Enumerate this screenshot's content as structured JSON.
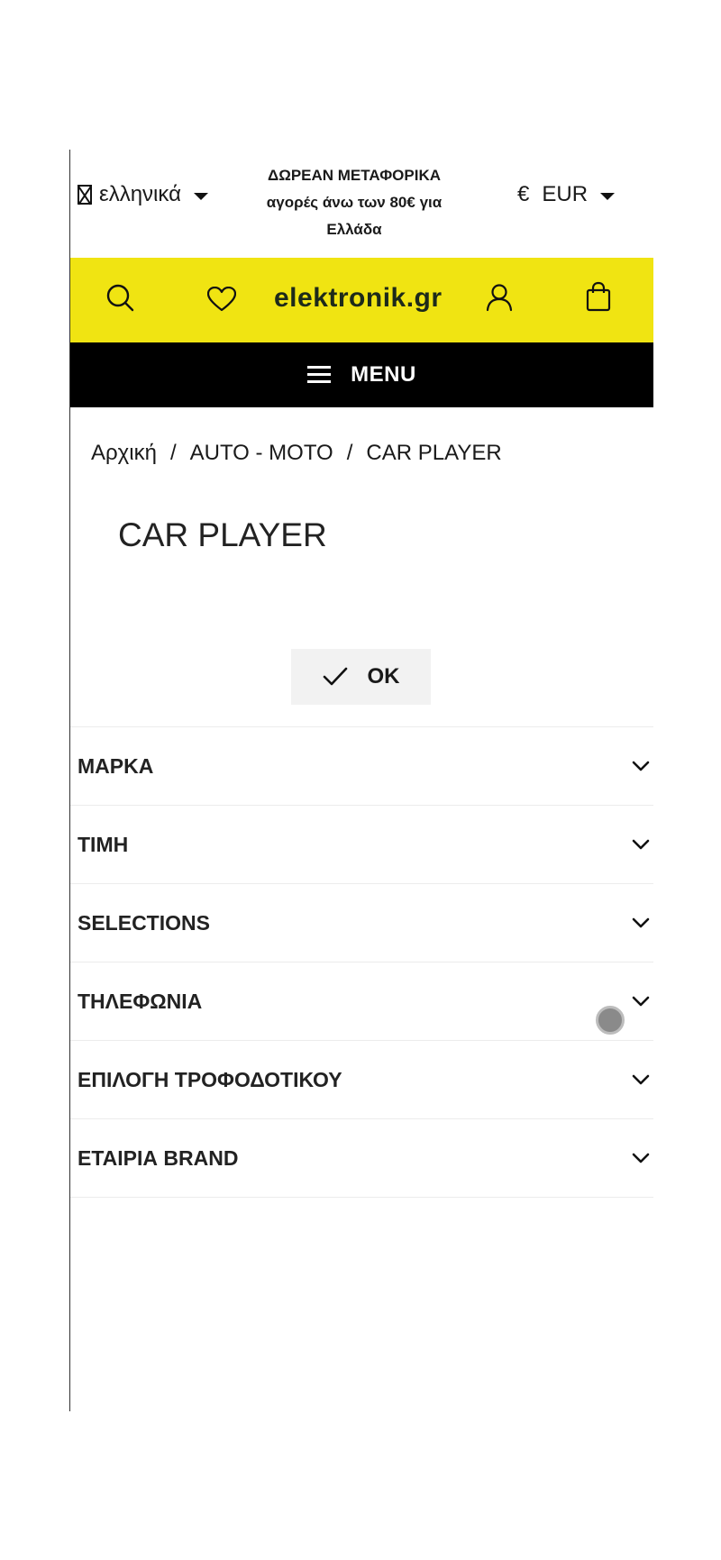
{
  "topbar": {
    "language": {
      "label": "ελληνικά",
      "icon": "flag-icon"
    },
    "shipping": {
      "line1": "ΔΩΡΕΑΝ ΜΕΤΑΦΟΡΙΚΑ",
      "line2": "αγορές άνω των 80€ για",
      "line3": "Ελλάδα"
    },
    "currency": {
      "symbol": "€",
      "code": "EUR"
    }
  },
  "header": {
    "logo": "elektronik.gr",
    "background": "#f0e412",
    "icons": [
      "search-icon",
      "heart-icon",
      "user-icon",
      "bag-icon"
    ]
  },
  "menu": {
    "label": "MENU"
  },
  "breadcrumb": {
    "items": [
      "Αρχική",
      "AUTO - MOTO",
      "CAR PLAYER"
    ],
    "separator": "/"
  },
  "page": {
    "title": "CAR PLAYER"
  },
  "ok_button": {
    "label": "OK"
  },
  "filters": [
    {
      "label": "ΜΑΡΚΑ"
    },
    {
      "label": "ΤΙΜΗ"
    },
    {
      "label": "SELECTIONS"
    },
    {
      "label": "ΤΗΛΕΦΩΝΙΑ"
    },
    {
      "label": "ΕΠΙΛΟΓΗ ΤΡΟΦΟΔΟΤΙΚΟΥ"
    },
    {
      "label": "ΕΤΑΙΡΙΑ BRAND"
    }
  ]
}
